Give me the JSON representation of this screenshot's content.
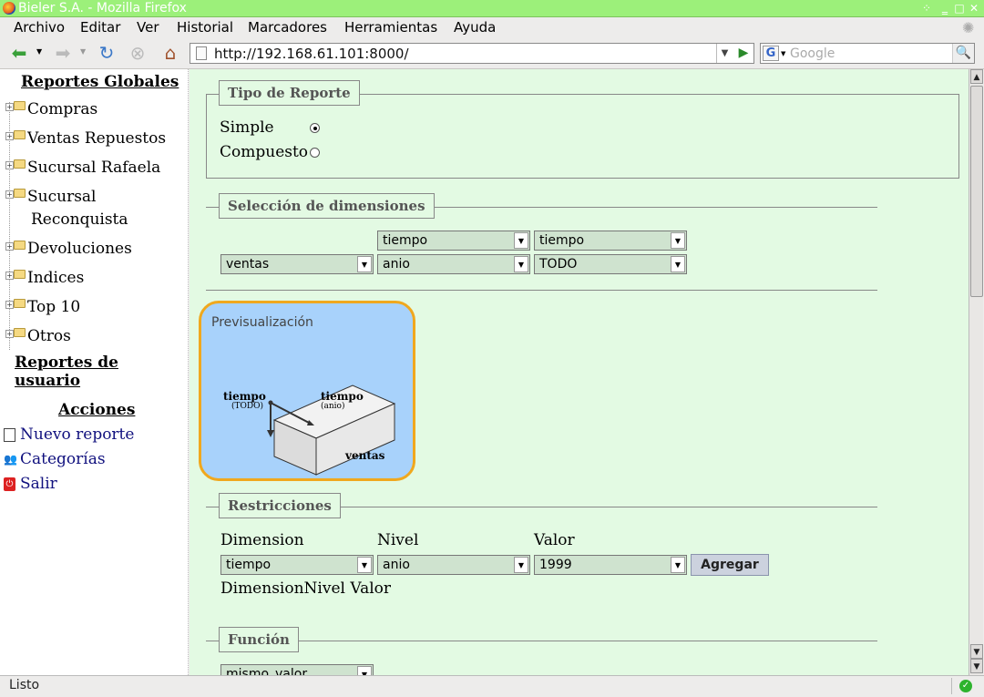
{
  "window": {
    "title": "Bieler S.A. - Mozilla Firefox"
  },
  "menu": [
    "Archivo",
    "Editar",
    "Ver",
    "Historial",
    "Marcadores",
    "Herramientas",
    "Ayuda"
  ],
  "nav": {
    "url": "http://192.168.61.101:8000/",
    "search_placeholder": "Google"
  },
  "sidebar": {
    "reportes_globales": "Reportes Globales",
    "tree": [
      "Compras",
      "Ventas Repuestos",
      "Sucursal Rafaela",
      "Sucursal",
      "Reconquista",
      "Devoluciones",
      "Indices",
      "Top 10",
      "Otros"
    ],
    "reportes_usuario": "Reportes de usuario",
    "acciones": "Acciones",
    "actions": [
      "Nuevo reporte",
      "Categorías",
      "Salir"
    ]
  },
  "tipo": {
    "legend": "Tipo de Reporte",
    "simple": "Simple",
    "compuesto": "Compuesto"
  },
  "dimensiones": {
    "legend": "Selección de dimensiones",
    "row1": [
      "tiempo",
      "tiempo"
    ],
    "row2": [
      "ventas",
      "anio",
      "TODO"
    ]
  },
  "preview": {
    "title": "Previsualización",
    "dim1": "tiempo",
    "dim1_sub": "(TODO)",
    "dim2": "tiempo",
    "dim2_sub": "(anio)",
    "dim3": "ventas"
  },
  "restricciones": {
    "legend": "Restricciones",
    "headers": [
      "Dimension",
      "Nivel",
      "Valor"
    ],
    "dimension": "tiempo",
    "nivel": "anio",
    "valor": "1999",
    "agregar": "Agregar",
    "list_headers": [
      "Dimension",
      "Nivel",
      "Valor"
    ]
  },
  "funcion": {
    "legend": "Función",
    "value": "mismo_valor"
  },
  "status": "Listo"
}
